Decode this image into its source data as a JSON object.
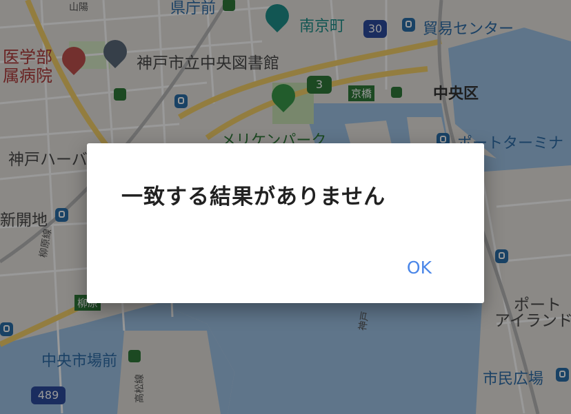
{
  "dialog": {
    "title": "一致する結果がありません",
    "ok_label": "OK"
  },
  "map": {
    "labels": {
      "kencho_mae": "県庁前",
      "nankinmachi": "南京町",
      "boeki_center": "貿易センター",
      "igakubu": "医学部",
      "fuzoku_byoin": "属病院",
      "library": "神戸市立中央図書館",
      "chuo_ku": "中央区",
      "kyobashi": "京橋",
      "meriken_park": "メリケンパーク",
      "port_terminal": "ポートターミナ",
      "kobe_harbor": "神戸ハーバ",
      "shinkaichi": "新開地",
      "port_island_1": "ポート",
      "port_island_2": "アイランド",
      "chuo_ichibamae": "中央市場前",
      "shimin_hiroba": "市民広場",
      "yanagihara_line": "柳原線",
      "yanagihara": "柳原",
      "kobe_line": "神戸",
      "takamatsu_line": "高松線",
      "sanyo": "山陽"
    },
    "route_shields": {
      "r30": "30",
      "r3": "3",
      "r489": "489"
    }
  }
}
